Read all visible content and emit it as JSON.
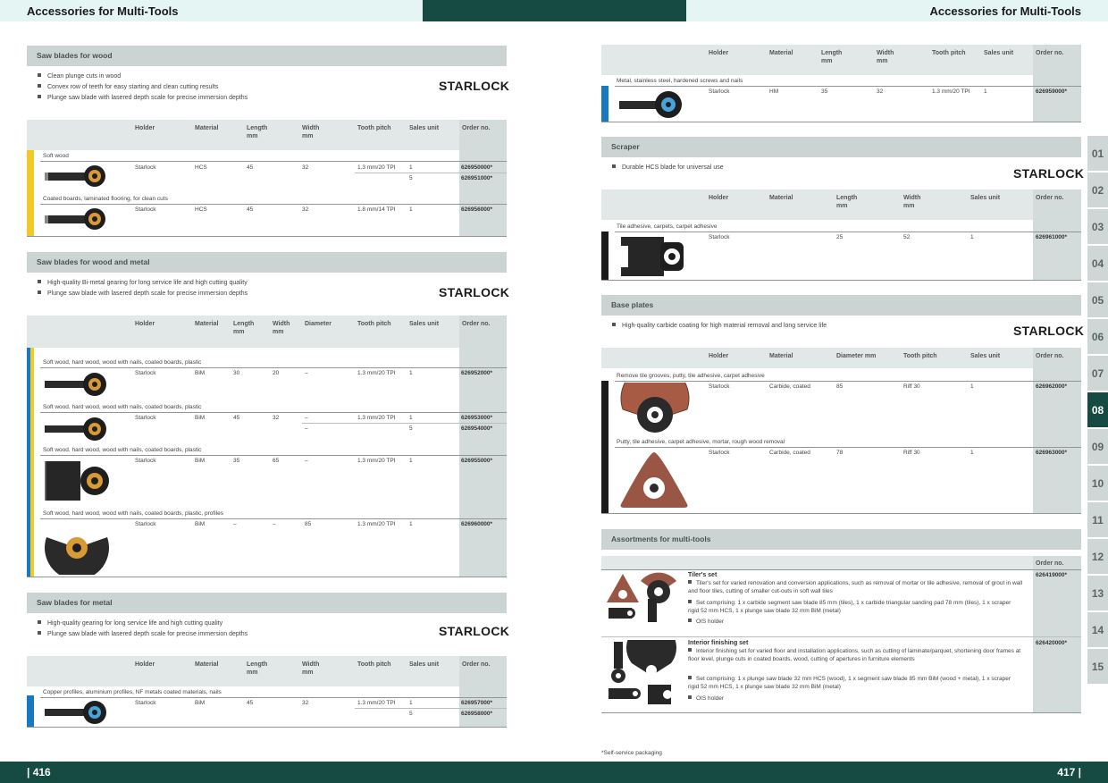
{
  "header": {
    "left_title": "Accessories for Multi-Tools",
    "right_title": "Accessories for Multi-Tools"
  },
  "footer": {
    "left_page": "| 416",
    "right_page": "417 |",
    "footnote": "*Self-service packaging"
  },
  "brand": {
    "logo": "STARLOCK"
  },
  "colors": {
    "dark_green": "#154b43",
    "mint": "#e4f5f3",
    "yellow": "#f2c92b",
    "blue": "#1978be",
    "section_grey": "#ccd3d3"
  },
  "tabs": [
    "01",
    "02",
    "03",
    "04",
    "05",
    "06",
    "07",
    "08",
    "09",
    "10",
    "11",
    "12",
    "13",
    "14",
    "15"
  ],
  "active_tab": "08",
  "wood": {
    "title": "Saw blades for wood",
    "bullets": [
      "Clean plunge cuts in wood",
      "Convex row of teeth for easy starting and clean cutting results",
      "Plunge saw blade with lasered depth scale for precise immersion depths"
    ],
    "headers": [
      "Holder",
      "Material",
      "Length\nmm",
      "Width\nmm",
      "Tooth pitch",
      "Sales unit",
      "Order no."
    ],
    "groups": [
      {
        "category": "Soft wood",
        "rows": [
          [
            "Starlock",
            "HCS",
            "45",
            "32",
            "1.3 mm/20 TPI",
            "1",
            "626950000*"
          ],
          [
            "",
            "",
            "",
            "",
            "",
            "5",
            "626951000*"
          ]
        ]
      },
      {
        "category": "Coated boards, laminated flooring, for clean cuts",
        "rows": [
          [
            "Starlock",
            "HCS",
            "45",
            "32",
            "1.8 mm/14 TPI",
            "1",
            "626956000*"
          ]
        ]
      }
    ]
  },
  "woodmetal": {
    "title": "Saw blades for wood and metal",
    "bullets": [
      "High-quality Bi-metal gearing for long service life and high cutting quality",
      "Plunge saw blade with lasered depth scale for precise immersion depths"
    ],
    "headers": [
      "Holder",
      "Material",
      "Length\nmm",
      "Width\nmm",
      "Diameter",
      "Tooth pitch",
      "Sales unit",
      "Order no."
    ],
    "groups": [
      {
        "category": "Soft wood, hard wood, wood with nails, coated boards, plastic",
        "rows": [
          [
            "Starlock",
            "BiM",
            "30",
            "20",
            "–",
            "1.3 mm/20 TPI",
            "1",
            "626952000*"
          ]
        ]
      },
      {
        "category": "Soft wood, hard wood, wood with nails, coated boards, plastic",
        "rows": [
          [
            "Starlock",
            "BiM",
            "45",
            "32",
            "–",
            "1.3 mm/20 TPI",
            "1",
            "626953000*"
          ],
          [
            "",
            "",
            "",
            "",
            "–",
            "",
            "5",
            "626954000*"
          ]
        ]
      },
      {
        "category": "Soft wood, hard wood, wood with nails, coated boards, plastic",
        "rows": [
          [
            "Starlock",
            "BiM",
            "35",
            "65",
            "–",
            "1.3 mm/20 TPI",
            "1",
            "626955000*"
          ]
        ]
      },
      {
        "category": "Soft wood, hard wood, wood with nails, coated boards, plastic, profiles",
        "rows": [
          [
            "Starlock",
            "BiM",
            "–",
            "–",
            "85",
            "1.3 mm/20 TPI",
            "1",
            "626960000*"
          ]
        ]
      }
    ]
  },
  "metal": {
    "title": "Saw blades for metal",
    "bullets": [
      "High-quality gearing for long service life and high cutting quality",
      "Plunge saw blade with lasered depth scale for precise immersion depths"
    ],
    "headers": [
      "Holder",
      "Material",
      "Length\nmm",
      "Width\nmm",
      "Tooth pitch",
      "Sales unit",
      "Order no."
    ],
    "groups": [
      {
        "category": "Copper profiles, aluminium profiles, NF metals coated materials, nails",
        "rows": [
          [
            "Starlock",
            "BiM",
            "45",
            "32",
            "1.3 mm/20 TPI",
            "1",
            "626957000*"
          ],
          [
            "",
            "",
            "",
            "",
            "",
            "5",
            "626958000*"
          ]
        ]
      }
    ]
  },
  "metal_stainless": {
    "headers": [
      "Holder",
      "Material",
      "Length\nmm",
      "Width\nmm",
      "Tooth pitch",
      "Sales unit",
      "Order no."
    ],
    "groups": [
      {
        "category": "Metal, stainless steel, hardened screws and nails",
        "rows": [
          [
            "Starlock",
            "HM",
            "35",
            "32",
            "1.3 mm/20 TPI",
            "1",
            "626959000*"
          ]
        ]
      }
    ]
  },
  "scraper": {
    "title": "Scraper",
    "bullets": [
      "Durable HCS blade for universal use"
    ],
    "headers": [
      "Holder",
      "Material",
      "Length\nmm",
      "Width\nmm",
      "Sales unit",
      "Order no."
    ],
    "groups": [
      {
        "category": "Tile adhesive, carpets, carpet adhesive",
        "rows": [
          [
            "Starlock",
            "",
            "25",
            "52",
            "1",
            "626961000*"
          ]
        ]
      }
    ]
  },
  "baseplates": {
    "title": "Base plates",
    "bullets": [
      "High-quality carbide coating for high material removal and long service life"
    ],
    "headers": [
      "Holder",
      "Material",
      "Diameter mm",
      "Tooth pitch",
      "Sales unit",
      "Order no."
    ],
    "groups": [
      {
        "category": "Remove tile grooves, putty, tile adhesive, carpet adhesive",
        "rows": [
          [
            "Starlock",
            "Carbide, coated",
            "85",
            "Riff 30",
            "1",
            "626962000*"
          ]
        ]
      },
      {
        "category": "Putty, tile adhesive, carpet adhesive, mortar, rough wood removal",
        "rows": [
          [
            "Starlock",
            "Carbide, coated",
            "78",
            "Riff 30",
            "1",
            "626963000*"
          ]
        ]
      }
    ]
  },
  "assortments": {
    "title": "Assortments for multi-tools",
    "order_header": "Order no.",
    "sets": [
      {
        "name": "Tiler's set",
        "order": "626419000*",
        "points": [
          "Tiler's set for varied renovation and conversion applications, such as removal of mortar or tile adhesive, removal of grout in wall and floor tiles, cutting of smaller cut-outs in soft wall tiles",
          "Set comprising: 1 x carbide segment saw blade 85 mm (tiles), 1 x carbide triangular sanding pad 78 mm (tiles), 1 x scraper rigid 52 mm HCS, 1 x plunge saw blade 32 mm BiM (metal)",
          "OIS holder"
        ]
      },
      {
        "name": "Interior finishing set",
        "order": "626420000*",
        "points": [
          "Interior finishing set for varied floor and installation applications, such as cutting of laminate/parquet, shortening door frames at floor level, plunge cuts in coated boards, wood, cutting of apertures in furniture elements",
          "Set comprising: 1 x plunge saw blade 32 mm HCS (wood), 1 x segment saw blade 85 mm BiM (wood + metal), 1 x scraper rigid 52 mm HCS, 1 x plunge saw blade 32 mm BiM (metal)",
          "OIS holder"
        ]
      }
    ]
  }
}
